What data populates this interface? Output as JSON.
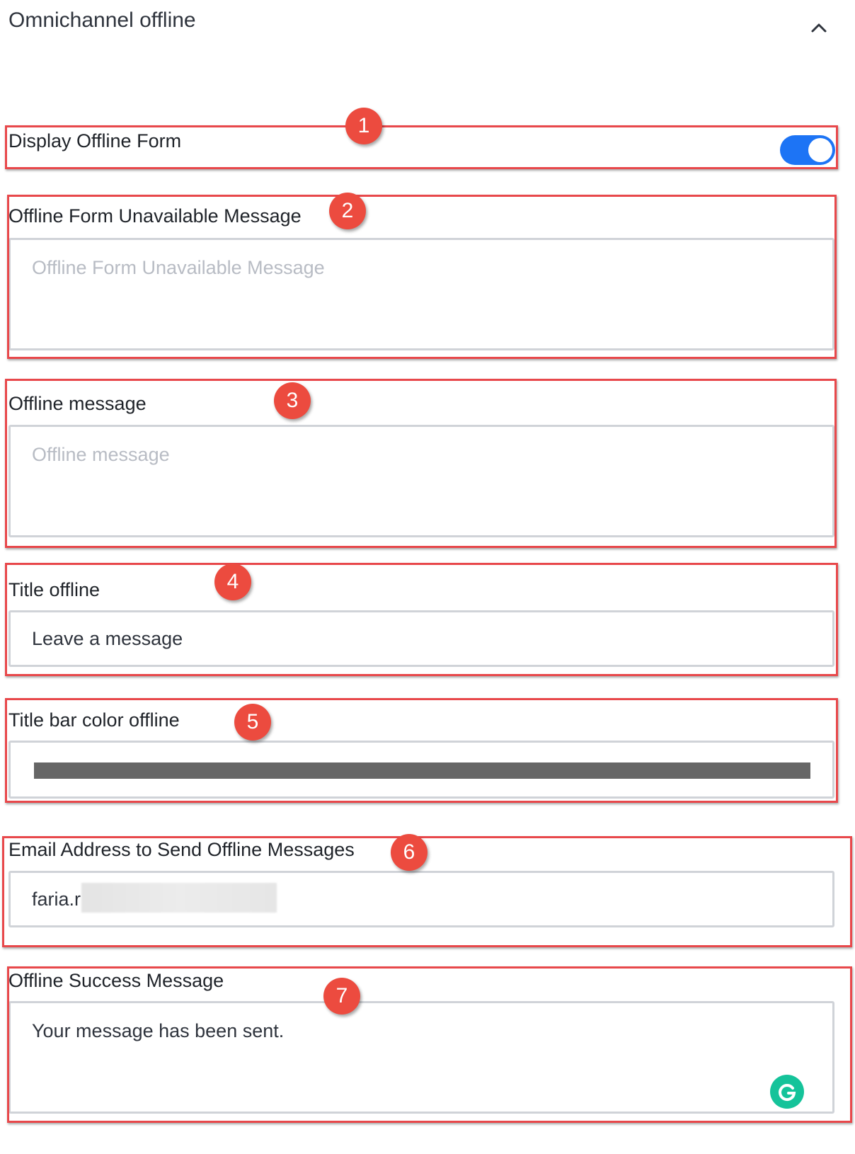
{
  "header": {
    "title": "Omnichannel offline",
    "collapse_icon": "chevron-up-icon"
  },
  "display_offline_form": {
    "label": "Display Offline Form",
    "enabled": true,
    "marker": "1"
  },
  "unavailable_message": {
    "label": "Offline Form Unavailable Message",
    "placeholder": "Offline Form Unavailable Message",
    "value": "",
    "marker": "2"
  },
  "offline_message": {
    "label": "Offline message",
    "placeholder": "Offline message",
    "value": "",
    "marker": "3"
  },
  "title_offline": {
    "label": "Title offline",
    "value": "Leave a message",
    "marker": "4"
  },
  "title_bar_color": {
    "label": "Title bar color offline",
    "color": "#666666",
    "marker": "5"
  },
  "email_address": {
    "label": "Email Address to Send Offline Messages",
    "value": "faria.r",
    "marker": "6"
  },
  "success_message": {
    "label": "Offline Success Message",
    "value": "Your message has been sent.",
    "marker": "7",
    "assistant_icon": "grammarly-icon"
  },
  "colors": {
    "accent": "#1d74f5",
    "annotation": "#ec4b3f",
    "grammarly": "#15c39a"
  }
}
